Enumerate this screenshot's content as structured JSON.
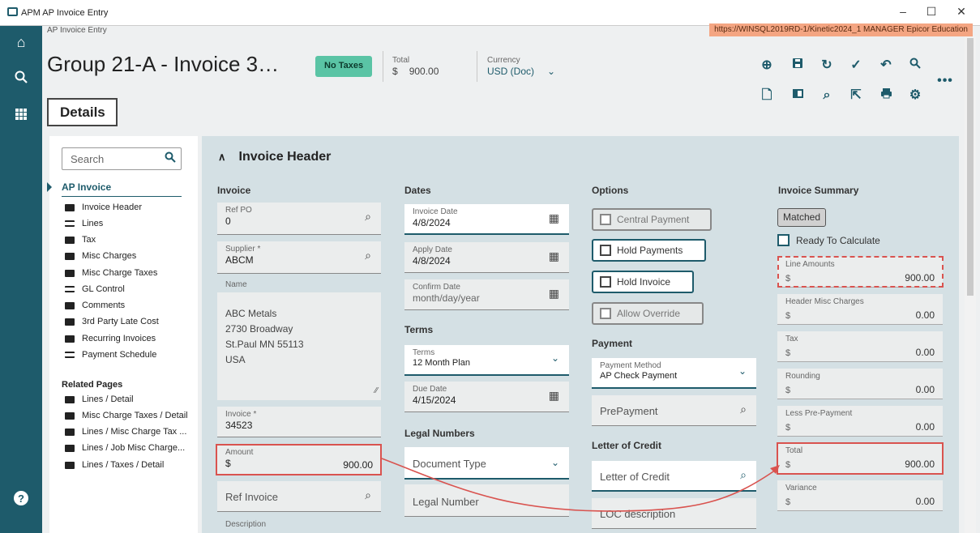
{
  "window": {
    "title": "APM AP Invoice Entry",
    "minimize": "–",
    "maximize": "☐",
    "close": "✕"
  },
  "breadcrumb": "AP Invoice Entry",
  "url": "https://WINSQL2019RD-1/Kinetic2024_1   MANAGER   Epicor Education",
  "header": {
    "title": "Group 21-A - Invoice 3…",
    "badge": "No Taxes",
    "total_label": "Total",
    "total_currency": "$",
    "total_value": "900.00",
    "currency_label": "Currency",
    "currency_value": "USD (Doc)"
  },
  "details_button": "Details",
  "leftnav": {
    "search_placeholder": "Search",
    "active": "AP Invoice",
    "items": [
      "Invoice Header",
      "Lines",
      "Tax",
      "Misc Charges",
      "Misc Charge Taxes",
      "GL Control",
      "Comments",
      "3rd Party Late Cost",
      "Recurring Invoices",
      "Payment Schedule"
    ],
    "related_head": "Related Pages",
    "related": [
      "Lines / Detail",
      "Misc Charge Taxes / Detail",
      "Lines / Misc Charge Tax ...",
      "Lines / Job Misc Charge...",
      "Lines / Taxes / Detail"
    ]
  },
  "section": {
    "title": "Invoice Header"
  },
  "invoice": {
    "head": "Invoice",
    "ref_po_label": "Ref PO",
    "ref_po": "0",
    "supplier_label": "Supplier *",
    "supplier": "ABCM",
    "name_label": "Name",
    "address1": "ABC Metals",
    "address2": "2730 Broadway",
    "address3": "St.Paul MN 55113",
    "address4": "USA",
    "invoice_label": "Invoice *",
    "invoice": "34523",
    "amount_label": "Amount",
    "amount_currency": "$",
    "amount": "900.00",
    "ref_invoice": "Ref Invoice",
    "description_label": "Description"
  },
  "dates": {
    "head": "Dates",
    "invoice_date_label": "Invoice Date",
    "invoice_date": "4/8/2024",
    "apply_date_label": "Apply Date",
    "apply_date": "4/8/2024",
    "confirm_date_label": "Confirm Date",
    "confirm_date_placeholder": "month/day/year",
    "terms_head": "Terms",
    "terms_label": "Terms",
    "terms": "12 Month Plan",
    "due_date_label": "Due Date",
    "due_date": "4/15/2024",
    "legal_head": "Legal Numbers",
    "document_type": "Document Type",
    "legal_number": "Legal Number"
  },
  "options": {
    "head": "Options",
    "central_payment": "Central Payment",
    "hold_payments": "Hold Payments",
    "hold_invoice": "Hold Invoice",
    "allow_override": "Allow Override",
    "payment_head": "Payment",
    "payment_method_label": "Payment Method",
    "payment_method": "AP Check Payment",
    "prepayment": "PrePayment",
    "loc_head": "Letter of Credit",
    "loc": "Letter of Credit",
    "loc_desc": "LOC description"
  },
  "summary": {
    "head": "Invoice Summary",
    "matched": "Matched",
    "ready": "Ready To Calculate",
    "rows": [
      {
        "label": "Line Amounts",
        "cur": "$",
        "value": "900.00"
      },
      {
        "label": "Header Misc Charges",
        "cur": "$",
        "value": "0.00"
      },
      {
        "label": "Tax",
        "cur": "$",
        "value": "0.00"
      },
      {
        "label": "Rounding",
        "cur": "$",
        "value": "0.00"
      },
      {
        "label": "Less Pre-Payment",
        "cur": "$",
        "value": "0.00"
      },
      {
        "label": "Total",
        "cur": "$",
        "value": "900.00"
      },
      {
        "label": "Variance",
        "cur": "$",
        "value": "0.00"
      }
    ]
  },
  "colors": {
    "rail": "#1e5b6b",
    "badge": "#5ac4a5",
    "highlight": "#d9534f",
    "url_bg": "#f4a582"
  }
}
